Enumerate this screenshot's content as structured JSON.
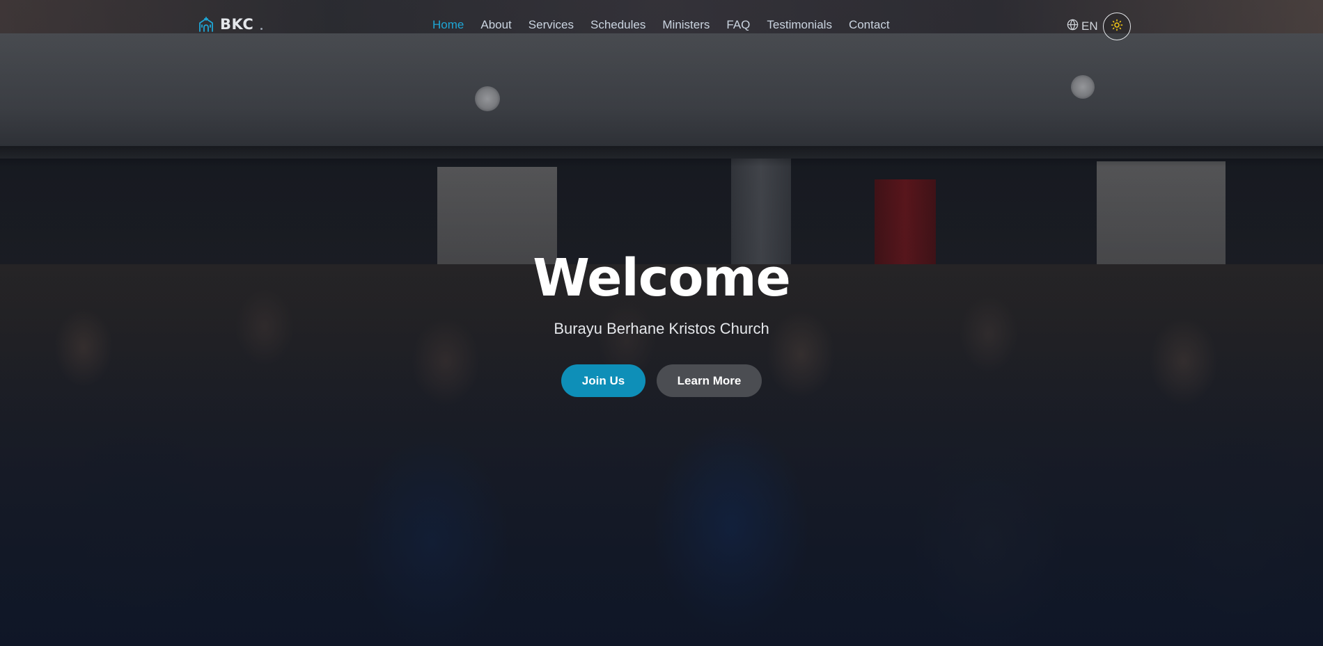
{
  "brand": {
    "name": "BKC",
    "icon": "church-icon"
  },
  "nav": {
    "items": [
      {
        "label": "Home",
        "active": true
      },
      {
        "label": "About",
        "active": false
      },
      {
        "label": "Services",
        "active": false
      },
      {
        "label": "Schedules",
        "active": false
      },
      {
        "label": "Ministers",
        "active": false
      },
      {
        "label": "FAQ",
        "active": false
      },
      {
        "label": "Testimonials",
        "active": false
      },
      {
        "label": "Contact",
        "active": false
      }
    ]
  },
  "language": {
    "label": "EN",
    "icon": "globe-icon"
  },
  "theme_toggle": {
    "icon": "sun-icon"
  },
  "hero": {
    "title": "Welcome",
    "subtitle": "Burayu Berhane Kristos Church",
    "primary_button": "Join Us",
    "secondary_button": "Learn More"
  },
  "colors": {
    "accent": "#1ea7d6",
    "primary_button": "#0e8fb8",
    "secondary_button": "#4b4d52",
    "sun": "#facc15"
  }
}
